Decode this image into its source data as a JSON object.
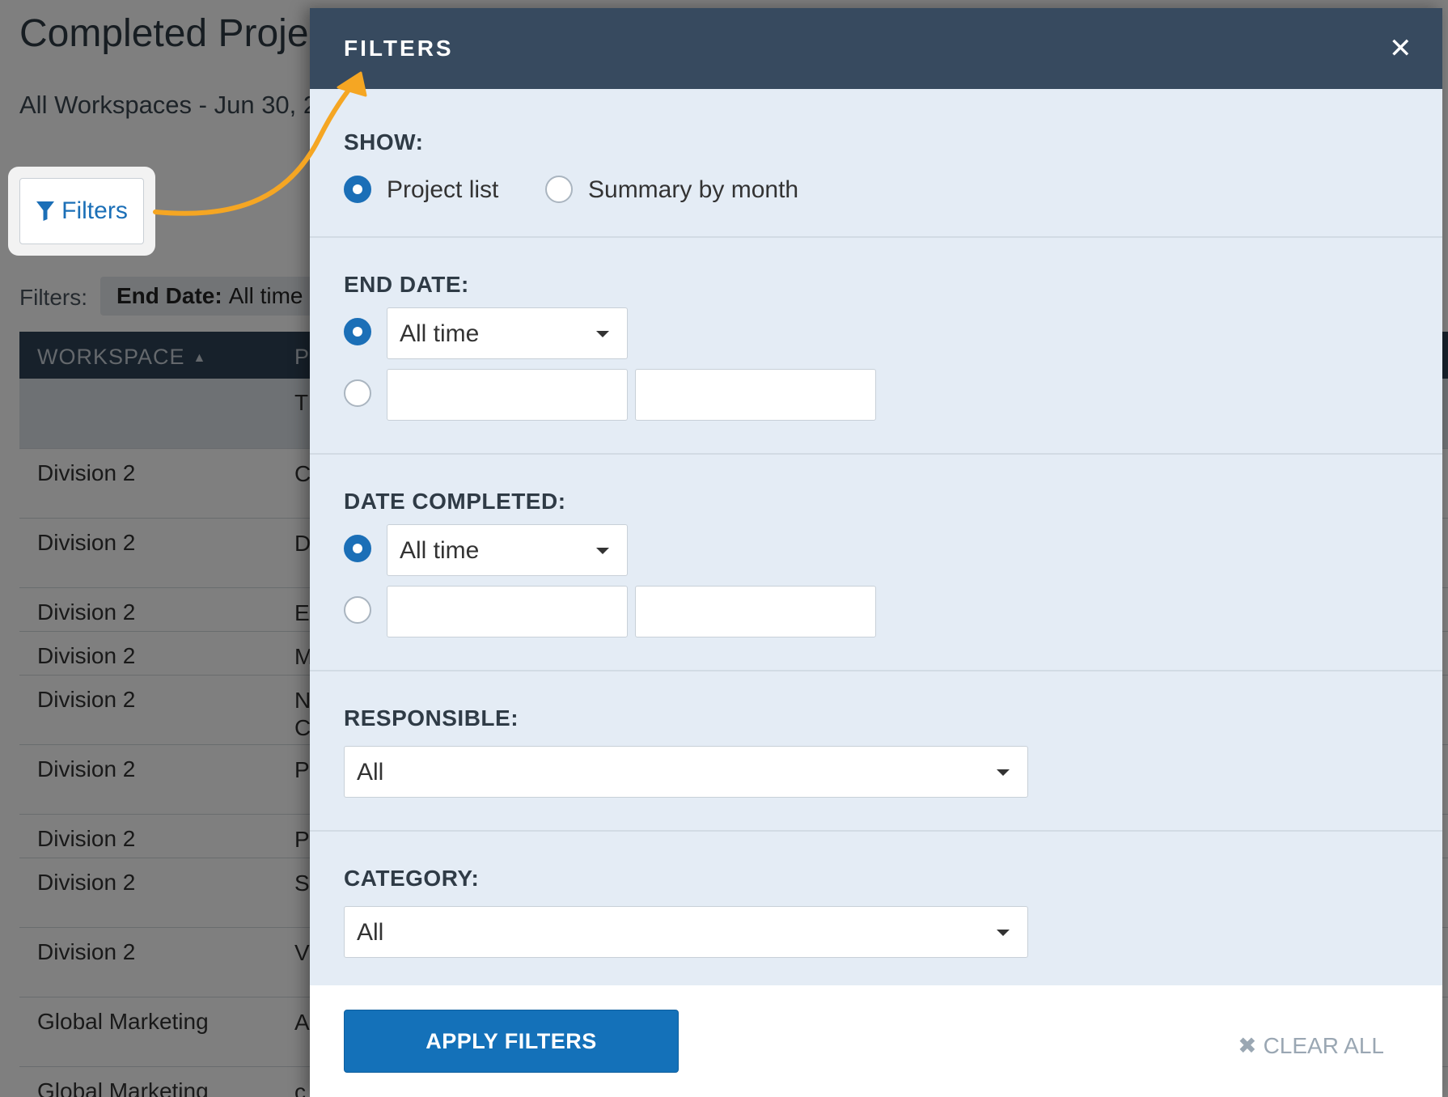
{
  "page": {
    "title": "Completed Projects",
    "subtitle": "All Workspaces - Jun 30, 2",
    "filters_button_label": "Filters",
    "active_filters_label": "Filters:",
    "chip_key": "End Date:",
    "chip_value": "All time"
  },
  "table": {
    "headers": [
      "WORKSPACE",
      "P"
    ],
    "subheader_cell": "T",
    "rows": [
      {
        "workspace": "Division 2",
        "col2": "C"
      },
      {
        "workspace": "Division 2",
        "col2": "D"
      },
      {
        "workspace": "Division 2",
        "col2": "E"
      },
      {
        "workspace": "Division 2",
        "col2": "M"
      },
      {
        "workspace": "Division 2",
        "col2": "N",
        "col2b": "C"
      },
      {
        "workspace": "Division 2",
        "col2": "P"
      },
      {
        "workspace": "Division 2",
        "col2": "P"
      },
      {
        "workspace": "Division 2",
        "col2": "S"
      },
      {
        "workspace": "Division 2",
        "col2": "V"
      },
      {
        "workspace": "Global Marketing",
        "col2": "A"
      },
      {
        "workspace": "Global Marketing",
        "col2": "c"
      }
    ]
  },
  "panel": {
    "title": "FILTERS",
    "close_glyph": "✕",
    "show": {
      "label": "SHOW:",
      "options": [
        "Project list",
        "Summary by month"
      ],
      "selected": "Project list"
    },
    "end_date": {
      "label": "END DATE:",
      "preset_value": "All time"
    },
    "date_completed": {
      "label": "DATE COMPLETED:",
      "preset_value": "All time"
    },
    "responsible": {
      "label": "RESPONSIBLE:",
      "value": "All"
    },
    "category": {
      "label": "CATEGORY:",
      "value": "All"
    },
    "apply_label": "APPLY FILTERS",
    "clear_label": "CLEAR ALL",
    "clear_glyph": "✖"
  },
  "colors": {
    "header_bg": "#374a5f",
    "panel_bg": "#e4ecf5",
    "accent_blue": "#1471b9",
    "arrow_orange": "#f5a623"
  },
  "icons": [
    "funnel-icon",
    "close-icon",
    "caret-down-icon",
    "sort-up-icon",
    "clear-x-icon",
    "arrow-annotation"
  ]
}
